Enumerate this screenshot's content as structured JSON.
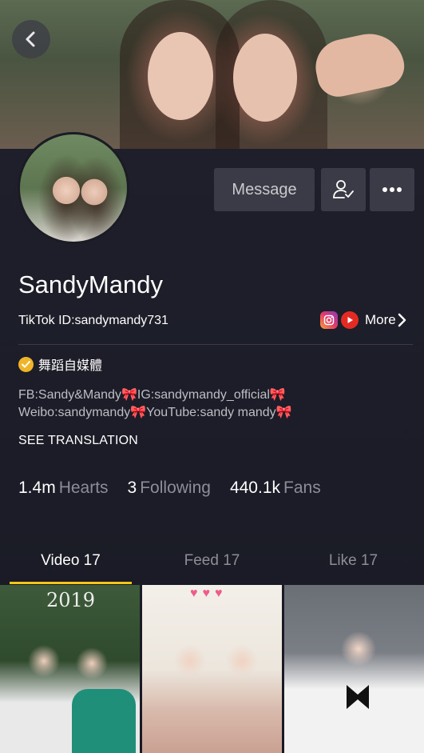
{
  "profile": {
    "username": "SandyMandy",
    "tiktok_id": "TikTok ID:sandymandy731",
    "verified_label": "舞蹈自媒體",
    "bio_line1_a": "FB:Sandy&Mandy",
    "bio_line1_b": "IG:sandymandy_official",
    "bio_line2_a": "Weibo:sandymandy",
    "bio_line2_b": "YouTube:sandy mandy",
    "ribbon": "🎀",
    "see_translation": "SEE TRANSLATION"
  },
  "actions": {
    "message_label": "Message",
    "more_link_label": "More"
  },
  "stats": [
    {
      "value": "1.4m",
      "label": "Hearts"
    },
    {
      "value": "3",
      "label": "Following"
    },
    {
      "value": "440.1k",
      "label": "Fans"
    }
  ],
  "tabs": [
    {
      "label": "Video 17",
      "active": true
    },
    {
      "label": "Feed 17",
      "active": false
    },
    {
      "label": "Like 17",
      "active": false
    }
  ],
  "thumbs": {
    "first_overlay": "2019"
  },
  "icons": {
    "back": "chevron-left-icon",
    "follow": "user-check-icon",
    "more": "ellipsis-icon",
    "instagram": "instagram-icon",
    "youtube": "youtube-icon",
    "verified": "check-badge-icon",
    "more_link": "chevron-right-icon"
  },
  "colors": {
    "accent_tab": "#f5c518",
    "verified_badge": "#f0b429",
    "youtube_red": "#e32b24",
    "background": "#161722"
  }
}
